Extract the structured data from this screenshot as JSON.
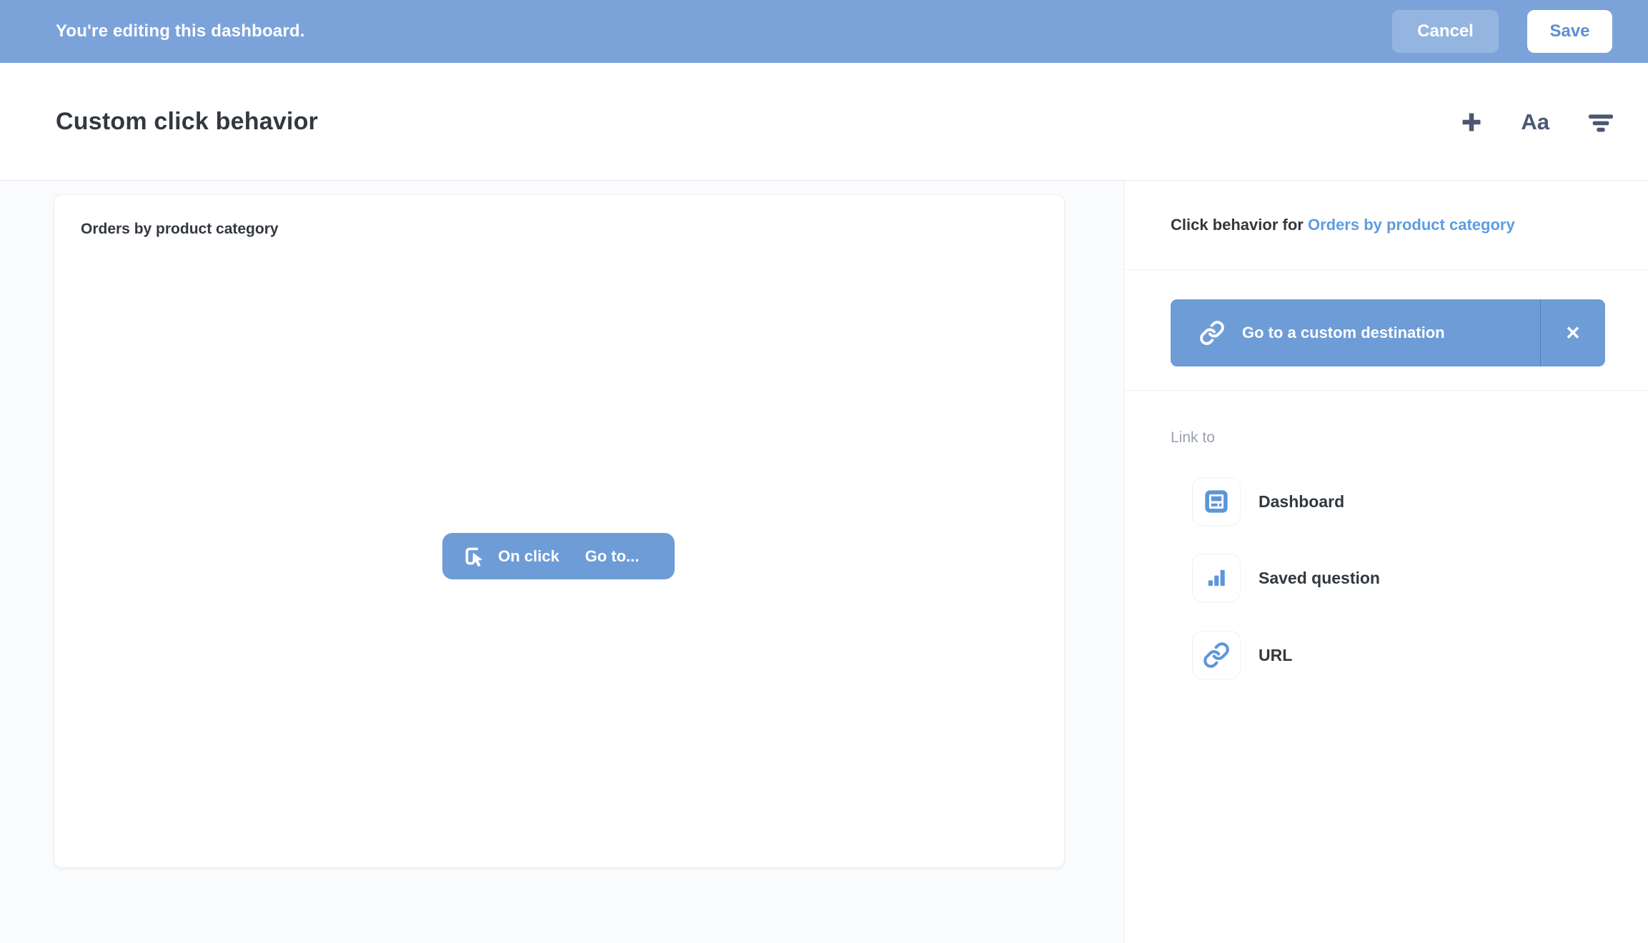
{
  "theme": {
    "banner-blue": "#7BA3DA",
    "button-blue": "#6E9CD6",
    "link-blue": "#5E9CDF",
    "icon-blue": "#5B96DB",
    "text-dark": "#32383E",
    "text-slate": "#4C5773",
    "text-gray": "#9BA1B0",
    "page-bg": "#F9FBFC",
    "divider": "#ECEEF1"
  },
  "banner": {
    "message": "You're editing this dashboard.",
    "cancel_label": "Cancel",
    "save_label": "Save"
  },
  "header": {
    "title": "Custom click behavior",
    "icons": [
      "plus-icon",
      "text-options-icon",
      "filter-icon"
    ],
    "text_options_label": "Aa"
  },
  "card": {
    "title": "Orders by product category",
    "onclick_label": "On click",
    "goto_label": "Go to..."
  },
  "sidebar": {
    "header_prefix": "Click behavior for ",
    "header_link": "Orders by product category",
    "destination": {
      "label": "Go to a custom destination",
      "close_label": "✕"
    },
    "link_to": {
      "section_label": "Link to",
      "items": [
        {
          "label": "Dashboard",
          "icon": "dashboard-icon"
        },
        {
          "label": "Saved question",
          "icon": "bar-chart-icon"
        },
        {
          "label": "URL",
          "icon": "link-icon"
        }
      ]
    }
  }
}
